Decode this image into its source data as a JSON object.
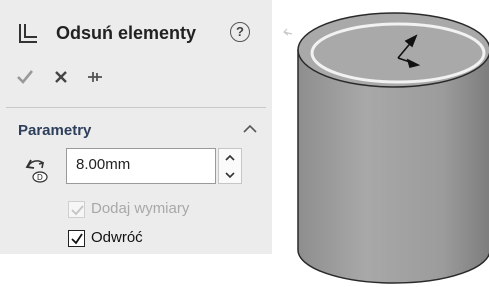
{
  "panel": {
    "title": "Odsuń elementy",
    "icons": {
      "feature": "offset-feature-icon",
      "help": "help-icon",
      "ok": "check-icon",
      "cancel": "close-icon",
      "pin": "pin-icon"
    },
    "help_symbol": "?"
  },
  "parameters": {
    "section_title": "Parametry",
    "distance_value": "8.00mm",
    "checkboxes": [
      {
        "label": "Dodaj wymiary",
        "checked": true,
        "enabled": false
      },
      {
        "label": "Odwróć",
        "checked": true,
        "enabled": true
      }
    ]
  },
  "colors": {
    "panel_bg": "#ececec",
    "section_title": "#2e3f5c",
    "cylinder_side": "#9a9a9a",
    "cylinder_top": "#a9a9a9",
    "offset_ring": "#f2f2f2"
  }
}
